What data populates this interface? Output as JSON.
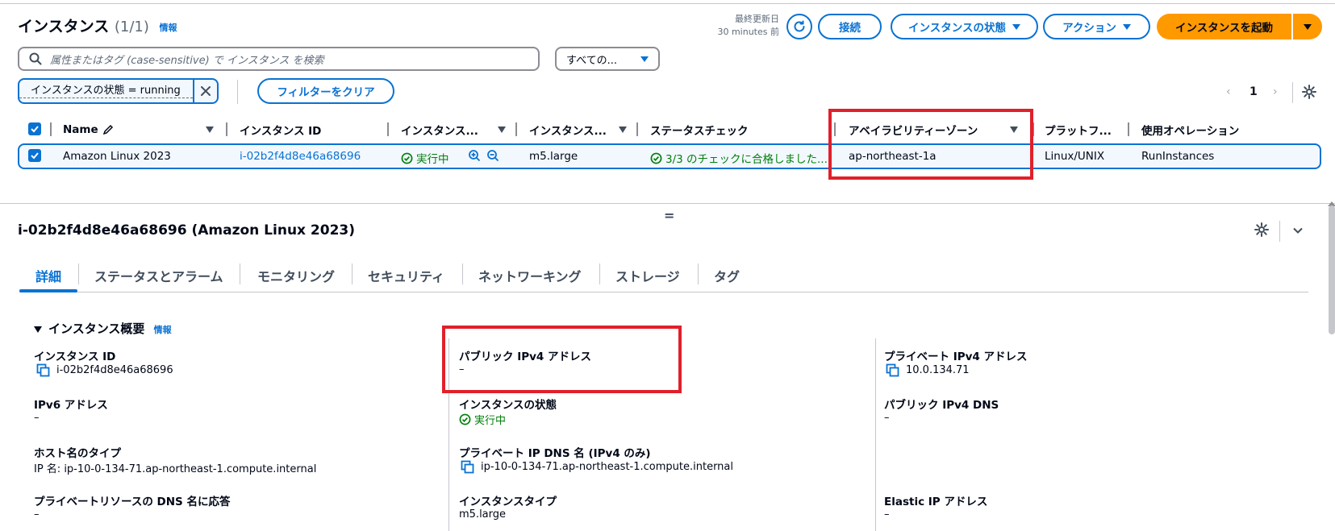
{
  "header": {
    "title": "インスタンス",
    "count": "(1/1)",
    "info": "情報",
    "last_updated_label": "最終更新日",
    "last_updated_value": "30 minutes 前",
    "connect": "接続",
    "instance_state": "インスタンスの状態",
    "actions": "アクション",
    "launch": "インスタンスを起動"
  },
  "search": {
    "placeholder": "属性またはタグ (case-sensitive) で インスタンス を検索",
    "select_value": "すべての..."
  },
  "filter": {
    "token": "インスタンスの状態 = running",
    "clear": "フィルターをクリア"
  },
  "pagination": {
    "current": "1",
    "prev": "‹",
    "next": "›"
  },
  "table": {
    "headers": [
      "Name",
      "インスタンス ID",
      "インスタンス...",
      "インスタンス...",
      "ステータスチェック",
      "アベイラビリティーゾーン",
      "プラットフ...",
      "使用オペレーション"
    ],
    "row": {
      "name": "Amazon Linux 2023",
      "instance_id": "i-02b2f4d8e46a68696",
      "state": "実行中",
      "type": "m5.large",
      "status_check": "3/3 のチェックに合格しました...",
      "az": "ap-northeast-1a",
      "platform": "Linux/UNIX",
      "operation": "RunInstances"
    }
  },
  "splitter": "=",
  "detail": {
    "title": "i-02b2f4d8e46a68696 (Amazon Linux 2023)",
    "tabs": [
      "詳細",
      "ステータスとアラーム",
      "モニタリング",
      "セキュリティ",
      "ネットワーキング",
      "ストレージ",
      "タグ"
    ],
    "section_title": "インスタンス概要",
    "section_info": "情報",
    "fields": {
      "instance_id_label": "インスタンス ID",
      "instance_id_value": "i-02b2f4d8e46a68696",
      "ipv6_label": "IPv6 アドレス",
      "ipv6_value": "–",
      "hostname_type_label": "ホスト名のタイプ",
      "hostname_type_value": "IP 名: ip-10-0-134-71.ap-northeast-1.compute.internal",
      "private_dns_respond_label": "プライベートリソースの DNS 名に応答",
      "private_dns_respond_value": "–",
      "public_ipv4_label": "パブリック IPv4 アドレス",
      "public_ipv4_value": "–",
      "state_label": "インスタンスの状態",
      "state_value": "実行中",
      "private_ip_dns_label": "プライベート IP DNS 名 (IPv4 のみ)",
      "private_ip_dns_value": "ip-10-0-134-71.ap-northeast-1.compute.internal",
      "instance_type_label": "インスタンスタイプ",
      "instance_type_value": "m5.large",
      "private_ipv4_label": "プライベート IPv4 アドレス",
      "private_ipv4_value": "10.0.134.71",
      "public_dns_label": "パブリック IPv4 DNS",
      "public_dns_value": "–",
      "elastic_ip_label": "Elastic IP アドレス",
      "elastic_ip_value": "–"
    }
  },
  "colors": {
    "accent": "#0972d3",
    "primary_button": "#ff9900",
    "success": "#037f0c",
    "annotation_red": "#e0202a"
  }
}
